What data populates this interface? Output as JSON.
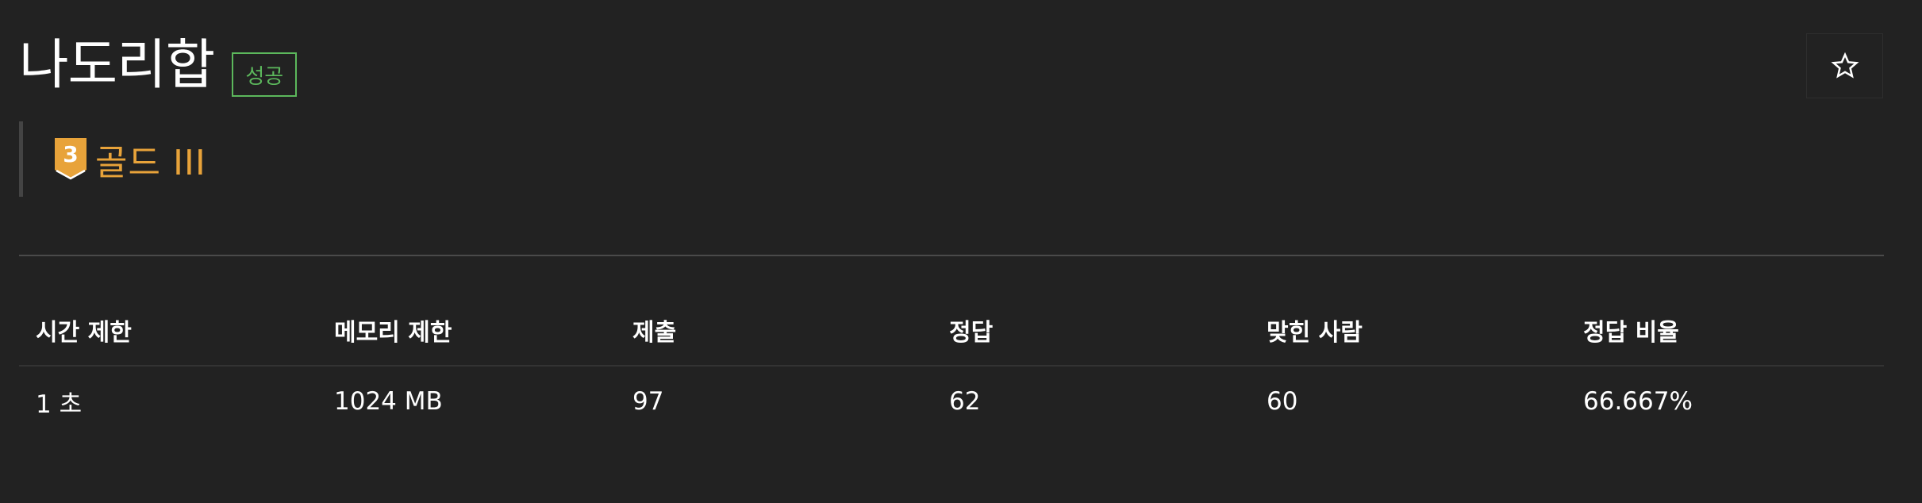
{
  "problem": {
    "title": "나도리합",
    "status_badge": "성공",
    "tier": {
      "number": "3",
      "label": "골드 III",
      "color": "#e8a33a"
    },
    "favorite_icon": "star-outline-icon"
  },
  "stats": {
    "headers": [
      "시간 제한",
      "메모리 제한",
      "제출",
      "정답",
      "맞힌 사람",
      "정답 비율"
    ],
    "values": [
      "1 초",
      "1024 MB",
      "97",
      "62",
      "60",
      "66.667%"
    ]
  },
  "colors": {
    "background": "#222222",
    "success": "#5cb85c",
    "gold": "#e8a33a"
  }
}
